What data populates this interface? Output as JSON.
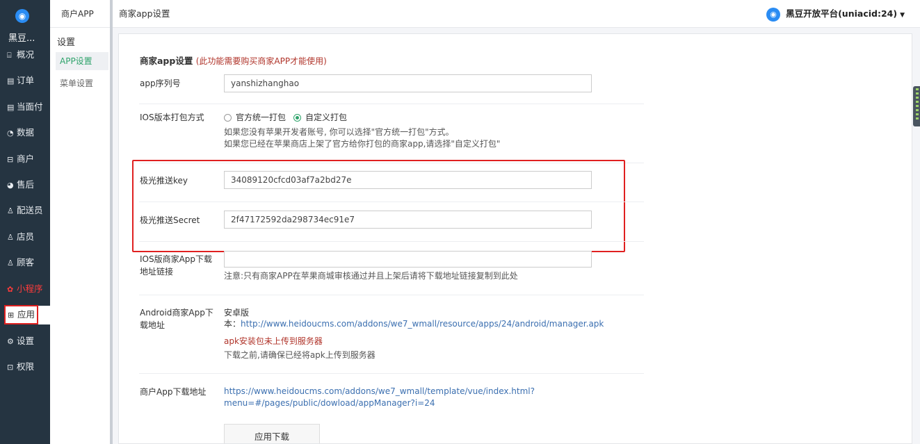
{
  "nav": {
    "brand": "黑豆...",
    "items": [
      {
        "icon": "⌸",
        "label": "概况"
      },
      {
        "icon": "▤",
        "label": "订单"
      },
      {
        "icon": "▤",
        "label": "当面付"
      },
      {
        "icon": "◔",
        "label": "数据"
      },
      {
        "icon": "⊟",
        "label": "商户"
      },
      {
        "icon": "◕",
        "label": "售后"
      },
      {
        "icon": "♙",
        "label": "配送员"
      },
      {
        "icon": "♙",
        "label": "店员"
      },
      {
        "icon": "♙",
        "label": "顾客"
      },
      {
        "icon": "✿",
        "label": "小程序"
      },
      {
        "icon": "⊞",
        "label": "应用"
      },
      {
        "icon": "⚙",
        "label": "设置"
      },
      {
        "icon": "⊡",
        "label": "权限"
      }
    ]
  },
  "subnav": {
    "header": "商户APP",
    "group": "设置",
    "items": [
      "APP设置",
      "菜单设置"
    ]
  },
  "topbar": {
    "title": "商家app设置",
    "user": "黑豆开放平台(uniacid:24)"
  },
  "form": {
    "title": "商家app设置",
    "title_note": "(此功能需要购买商家APP才能使用)",
    "serial_label": "app序列号",
    "serial_value": "yanshizhanghao",
    "ios_pack_label": "IOS版本打包方式",
    "ios_pack_options": [
      "官方统一打包",
      "自定义打包"
    ],
    "ios_pack_selected": "自定义打包",
    "ios_pack_help1": "如果您没有苹果开发者账号, 你可以选择\"官方统一打包\"方式。",
    "ios_pack_help2": "如果您已经在苹果商店上架了官方给你打包的商家app,请选择\"自定义打包\"",
    "push_key_label": "极光推送key",
    "push_key_value": "34089120cfcd03af7a2bd27e",
    "push_secret_label": "极光推送Secret",
    "push_secret_value": "2f47172592da298734ec91e7",
    "ios_link_label": "IOS版商家App下载地址链接",
    "ios_link_value": "",
    "ios_link_help": "注意:只有商家APP在苹果商城审核通过并且上架后请将下载地址链接复制到此处",
    "android_label": "Android商家App下载地址",
    "android_version": "安卓版",
    "android_url_prefix": "本：",
    "android_url": "http://www.heidoucms.com/addons/we7_wmall/resource/apps/24/android/manager.apk",
    "android_warn": "apk安装包未上传到服务器",
    "android_help": "下载之前,请确保已经将apk上传到服务器",
    "merchant_label": "商户App下载地址",
    "merchant_url_1": "https://www.heidoucms.com/addons/we7_wmall/template/vue/index.html?",
    "merchant_url_2": "menu=#/pages/public/dowload/appManager?i=24",
    "download_button": "应用下载"
  },
  "colors": {
    "sidebar_bg": "#253441",
    "accent_green": "#2fa36b",
    "link_blue": "#3b6fb0",
    "warn_red": "#b0342a",
    "highlight_red": "#e02020"
  }
}
